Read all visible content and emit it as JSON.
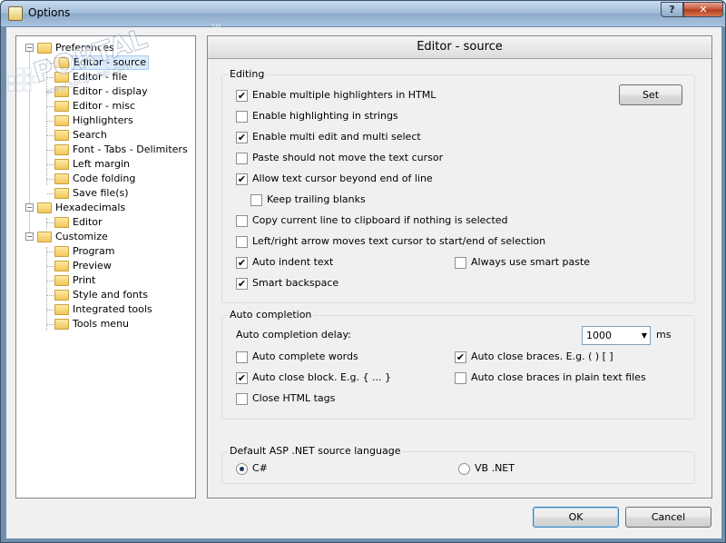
{
  "window": {
    "title": "Options",
    "help_label": "?",
    "close_label": "✕"
  },
  "tree": [
    {
      "label": "Preferences",
      "level": 0,
      "expander": "−"
    },
    {
      "label": "Editor - source",
      "level": 1,
      "selected": true
    },
    {
      "label": "Editor - file",
      "level": 1
    },
    {
      "label": "Editor - display",
      "level": 1
    },
    {
      "label": "Editor - misc",
      "level": 1
    },
    {
      "label": "Highlighters",
      "level": 1
    },
    {
      "label": "Search",
      "level": 1
    },
    {
      "label": "Font - Tabs - Delimiters",
      "level": 1
    },
    {
      "label": "Left margin",
      "level": 1
    },
    {
      "label": "Code folding",
      "level": 1
    },
    {
      "label": "Save file(s)",
      "level": 1
    },
    {
      "label": "Hexadecimals",
      "level": 0,
      "expander": "−"
    },
    {
      "label": "Editor",
      "level": 1
    },
    {
      "label": "Customize",
      "level": 0,
      "expander": "−"
    },
    {
      "label": "Program",
      "level": 1
    },
    {
      "label": "Preview",
      "level": 1
    },
    {
      "label": "Print",
      "level": 1
    },
    {
      "label": "Style and fonts",
      "level": 1
    },
    {
      "label": "Integrated tools",
      "level": 1
    },
    {
      "label": "Tools menu",
      "level": 1
    }
  ],
  "panel": {
    "title": "Editor - source"
  },
  "editing": {
    "title": "Editing",
    "set_button": "Set",
    "options": [
      {
        "label": "Enable multiple highlighters in HTML",
        "checked": true
      },
      {
        "label": "Enable highlighting in strings",
        "checked": false
      },
      {
        "label": "Enable multi edit and multi select",
        "checked": true
      },
      {
        "label": "Paste should not move the text cursor",
        "checked": false
      },
      {
        "label": "Allow text cursor beyond end of line",
        "checked": true
      },
      {
        "label": "Keep trailing blanks",
        "checked": false
      },
      {
        "label": "Copy current line to clipboard if nothing is selected",
        "checked": false
      },
      {
        "label": "Left/right arrow moves text cursor to start/end of selection",
        "checked": false
      },
      {
        "label": "Auto indent text",
        "checked": true
      },
      {
        "label": "Always use smart paste",
        "checked": false
      },
      {
        "label": "Smart backspace",
        "checked": true
      }
    ]
  },
  "auto_completion": {
    "title": "Auto completion",
    "delay_label": "Auto completion delay:",
    "delay_value": "1000",
    "delay_unit": "ms",
    "options": [
      {
        "label": "Auto complete words",
        "checked": false
      },
      {
        "label": "Auto close braces. E.g. ( ) [ ]",
        "checked": true
      },
      {
        "label": "Auto close block. E.g. { ... }",
        "checked": true
      },
      {
        "label": "Auto close braces in plain text files",
        "checked": false
      },
      {
        "label": "Close HTML tags",
        "checked": false
      }
    ]
  },
  "asp": {
    "title": "Default ASP .NET source language",
    "options": [
      {
        "label": "C#",
        "selected": true
      },
      {
        "label": "VB .NET",
        "selected": false
      }
    ]
  },
  "footer": {
    "ok_label": "OK",
    "cancel_label": "Cancel"
  },
  "watermark": {
    "text": "PORTAL",
    "url": "www.softportal.com",
    "mark": "SM"
  },
  "colors": {
    "selection_bg": "#dcebfc",
    "title_bar": "#9fbad7"
  }
}
